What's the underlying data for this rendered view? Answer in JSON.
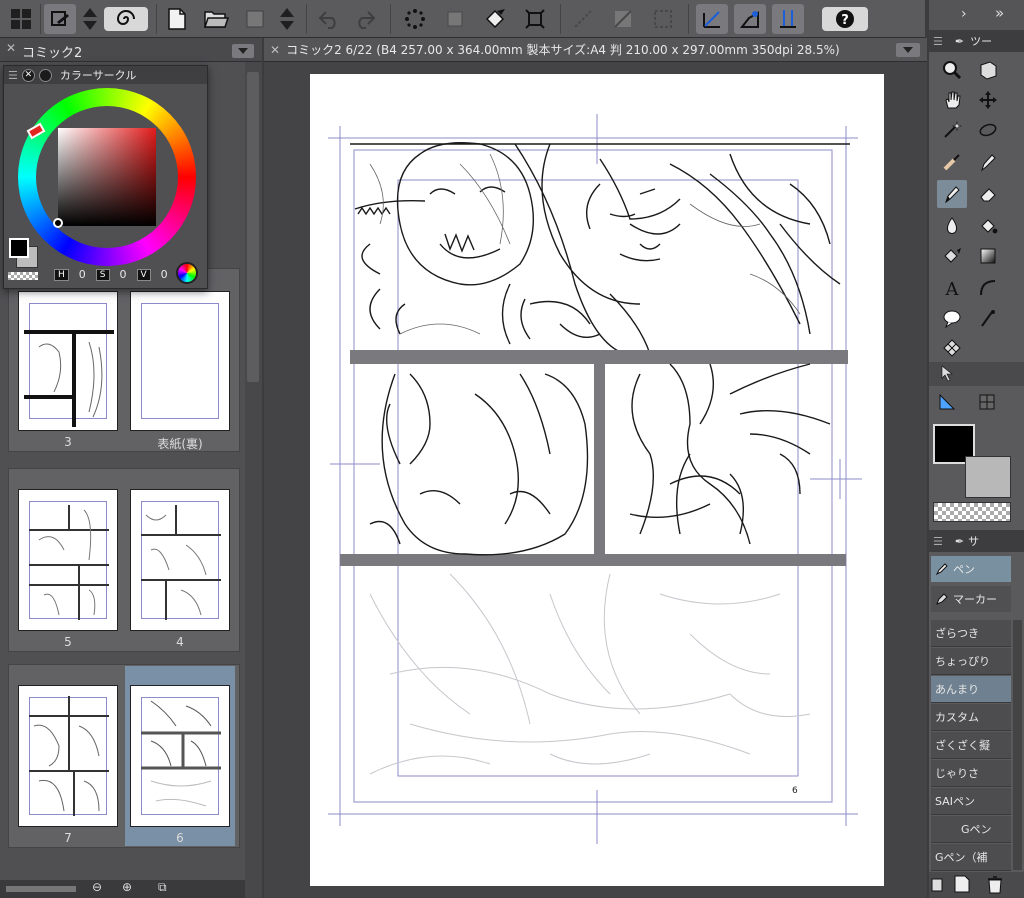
{
  "toolbar": {
    "buttons": [
      "grid-menu-icon",
      "quick-access-icon",
      "up-down-icon",
      "spiral-icon",
      "new-file-icon",
      "open-folder-icon",
      "save-icon",
      "scroll-icon",
      "undo-icon",
      "redo-icon",
      "transform-icon",
      "clear-icon",
      "fill-icon",
      "crop-icon",
      "ruler-off-icon",
      "ruler-icon",
      "selection-icon",
      "snap-ruler-icon",
      "snap-special-icon",
      "snap-grid-icon",
      "help-icon"
    ]
  },
  "left_panel": {
    "tab_label": "コミック2",
    "color_panel": {
      "title": "カラーサークル",
      "h_label": "H",
      "h_value": "0",
      "s_label": "S",
      "s_value": "0",
      "v_label": "V",
      "v_value": "0",
      "current_color": "#000000"
    },
    "pages": [
      {
        "label": "3"
      },
      {
        "label": "表紙(裏)"
      },
      {
        "label": "5"
      },
      {
        "label": "4"
      },
      {
        "label": "7"
      },
      {
        "label": "6"
      }
    ]
  },
  "canvas": {
    "tab_title": "コミック2 6/22 (B4 257.00 x 364.00mm 製本サイズ:A4 判 210.00 x 297.00mm 350dpi 28.5%)",
    "page_number": "6"
  },
  "right_panel": {
    "tool_tab_label": "ツー",
    "subtool_tab_label": "サ",
    "subtools": [
      {
        "label": "ペン",
        "active": true
      },
      {
        "label": "マーカー",
        "active": false
      }
    ],
    "brushes": [
      {
        "label": "ざらつき",
        "active": false
      },
      {
        "label": "ちょっぴり",
        "active": false
      },
      {
        "label": "あんまり",
        "active": true
      },
      {
        "label": "カスタム",
        "active": false
      },
      {
        "label": "ざくざく擬",
        "active": false
      },
      {
        "label": "じゃりさ",
        "active": false
      },
      {
        "label": "SAIペン",
        "active": false
      },
      {
        "label": "Gペン",
        "active": false
      },
      {
        "label": "Gペン（補",
        "active": false
      }
    ],
    "main_color": "#000000",
    "sub_color": "#b8b8b8"
  }
}
